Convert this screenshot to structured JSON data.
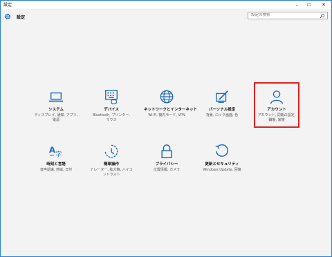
{
  "window": {
    "title": "設定",
    "minimize": "–",
    "maximize": "☐",
    "close": "✕"
  },
  "header": {
    "title": "設定",
    "search_placeholder": "設定の検索"
  },
  "colors": {
    "accent": "#1e6bbf",
    "selected_border": "#e02020"
  },
  "tiles": [
    {
      "label": "システム",
      "desc_line1": "ディスプレイ, 通知, アプリ,",
      "desc_line2": "電源",
      "icon": "laptop-icon"
    },
    {
      "label": "デバイス",
      "desc_line1": "Bluetooth, プリンター,",
      "desc_line2": "マウス",
      "icon": "keyboard-icon"
    },
    {
      "label": "ネットワークとインターネット",
      "desc_line1": "Wi-Fi, 機内モード, VPN",
      "desc_line2": "",
      "icon": "globe-icon"
    },
    {
      "label": "パーソナル設定",
      "desc_line1": "背景, ロック画面, 色",
      "desc_line2": "",
      "icon": "paint-icon"
    },
    {
      "label": "アカウント",
      "desc_line1": "アカウント, 同期の設定,",
      "desc_line2": "職場, 家族",
      "icon": "person-icon"
    },
    {
      "label": "時刻と言語",
      "desc_line1": "音声認識, 地域, 日付",
      "desc_line2": "",
      "icon": "language-icon"
    },
    {
      "label": "簡単操作",
      "desc_line1": "ナレーター, 拡大鏡, ハイコ",
      "desc_line2": "ントラスト",
      "icon": "ease-of-access-icon"
    },
    {
      "label": "プライバシー",
      "desc_line1": "位置情報, カメラ",
      "desc_line2": "",
      "icon": "lock-icon"
    },
    {
      "label": "更新とセキュリティ",
      "desc_line1": "Windows Update, 回復",
      "desc_line2": "",
      "icon": "update-icon"
    }
  ]
}
